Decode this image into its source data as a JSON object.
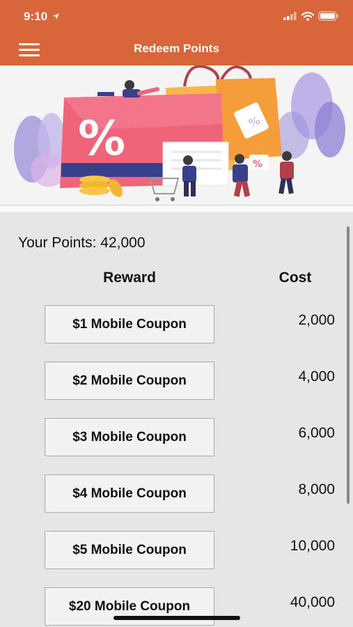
{
  "status_bar": {
    "time": "9:10"
  },
  "header": {
    "title": "Redeem Points"
  },
  "points": {
    "label": "Your Points: 42,000"
  },
  "table": {
    "reward_header": "Reward",
    "cost_header": "Cost",
    "rows": [
      {
        "reward": "$1 Mobile Coupon",
        "cost": "2,000"
      },
      {
        "reward": "$2 Mobile Coupon",
        "cost": "4,000"
      },
      {
        "reward": "$3 Mobile Coupon",
        "cost": "6,000"
      },
      {
        "reward": "$4 Mobile Coupon",
        "cost": "8,000"
      },
      {
        "reward": "$5 Mobile Coupon",
        "cost": "10,000"
      },
      {
        "reward": "$20 Mobile Coupon",
        "cost": "40,000"
      }
    ]
  },
  "colors": {
    "header_bg": "#d9653a",
    "content_bg": "#e6e6e6",
    "button_bg": "#f2f2f2"
  },
  "icons": [
    "location-arrow-icon",
    "signal-icon",
    "wifi-icon",
    "battery-icon",
    "hamburger-menu-icon"
  ]
}
